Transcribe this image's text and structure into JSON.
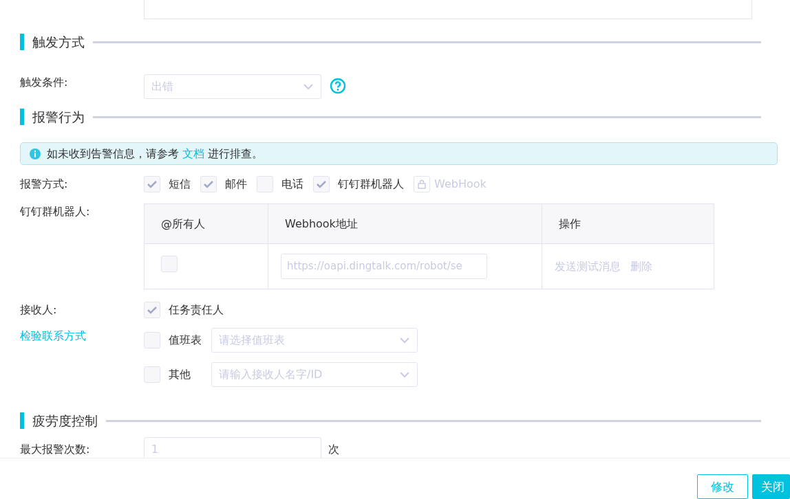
{
  "trigger": {
    "title": "触发方式",
    "condition": {
      "label": "触发条件:",
      "value": "出错"
    }
  },
  "alert": {
    "title": "报警行为",
    "notice": {
      "text": "如未收到告警信息，请参考 ",
      "link": "文档",
      "suffix": " 进行排查。"
    },
    "methods": {
      "label": "报警方式:",
      "options": [
        {
          "kind": "checkbox",
          "label": "短信",
          "checked": true
        },
        {
          "kind": "checkbox",
          "label": "邮件",
          "checked": true
        },
        {
          "kind": "checkbox",
          "label": "电话",
          "checked": false
        },
        {
          "kind": "checkbox",
          "label": "钉钉群机器人",
          "checked": true
        },
        {
          "kind": "locked",
          "label": "WebHook"
        }
      ]
    },
    "robots": {
      "label": "钉钉群机器人:",
      "columns": [
        "@所有人",
        "Webhook地址",
        "操作"
      ],
      "rows": [
        {
          "at_all": false,
          "webhook": "https://oapi.dingtalk.com/robot/se",
          "actions": [
            "发送测试消息",
            "删除"
          ]
        }
      ]
    },
    "receivers": {
      "label": "接收人:",
      "link": "检验联系方式",
      "options": [
        {
          "label": "任务责任人",
          "checked": true
        },
        {
          "label": "值班表",
          "checked": false,
          "placeholder": "请选择值班表"
        },
        {
          "label": "其他",
          "checked": false,
          "placeholder": "请输入接收人名字/ID"
        }
      ]
    }
  },
  "fatigue": {
    "title": "疲劳度控制",
    "max": {
      "label": "最大报警次数:",
      "value": "1",
      "unit": "次"
    }
  },
  "footer": {
    "buttons": [
      {
        "label": "修改",
        "kind": "outline"
      },
      {
        "label": "关闭",
        "kind": "primary"
      }
    ]
  }
}
